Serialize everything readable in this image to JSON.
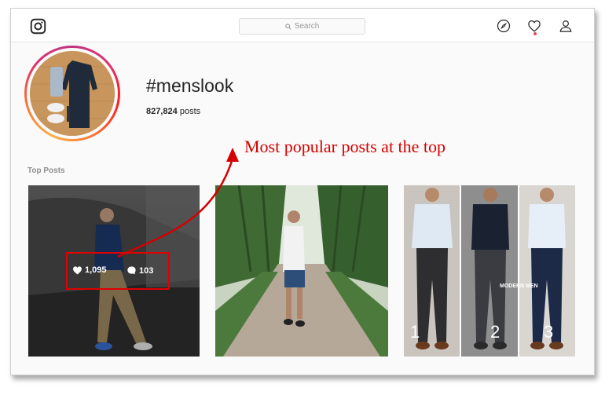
{
  "header": {
    "search_placeholder": "Search",
    "nav_icons": [
      "explore-compass-icon",
      "heart-icon",
      "profile-icon"
    ]
  },
  "hashtag": {
    "title": "#menslook",
    "post_count": "827,824",
    "post_count_suffix": "posts"
  },
  "section": {
    "top_posts_label": "Top Posts"
  },
  "posts": [
    {
      "likes": "1,095",
      "comments": "103"
    },
    {},
    {
      "collage_labels": [
        "1",
        "2",
        "3"
      ],
      "caption": "MODERN MEN"
    }
  ],
  "annotation": {
    "text": "Most popular posts at the top",
    "color": "#d40000"
  },
  "colors": {
    "highlight_box": "#e00000",
    "story_ring": [
      "#c13584",
      "#e1306c",
      "#fd1d1d",
      "#f77737",
      "#fcaf45"
    ]
  }
}
